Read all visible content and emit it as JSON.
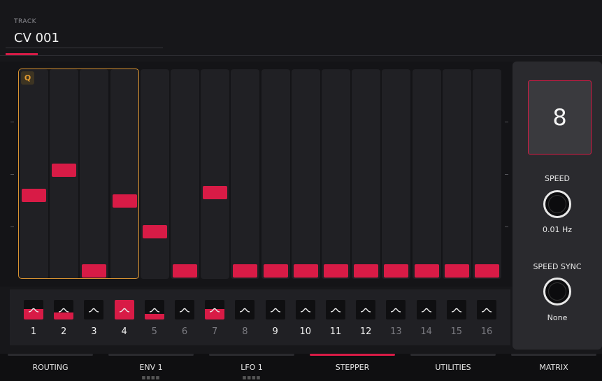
{
  "track": {
    "label": "TRACK",
    "name": "CV 001"
  },
  "quantize_badge": "Q",
  "steps": [
    {
      "number": "1",
      "level": 0.54,
      "button_fill": 0.55,
      "dim": false
    },
    {
      "number": "2",
      "level": 0.72,
      "button_fill": 0.35,
      "dim": false
    },
    {
      "number": "3",
      "level": 0.0,
      "button_fill": 0.0,
      "dim": false
    },
    {
      "number": "4",
      "level": 0.5,
      "button_fill": 1.0,
      "dim": false
    },
    {
      "number": "5",
      "level": 0.28,
      "button_fill": 0.3,
      "dim": true
    },
    {
      "number": "6",
      "level": 0.0,
      "button_fill": 0.0,
      "dim": true
    },
    {
      "number": "7",
      "level": 0.56,
      "button_fill": 0.55,
      "dim": true
    },
    {
      "number": "8",
      "level": 0.0,
      "button_fill": 0.0,
      "dim": true
    },
    {
      "number": "9",
      "level": 0.0,
      "button_fill": 0.0,
      "dim": false
    },
    {
      "number": "10",
      "level": 0.0,
      "button_fill": 0.0,
      "dim": false
    },
    {
      "number": "11",
      "level": 0.0,
      "button_fill": 0.0,
      "dim": false
    },
    {
      "number": "12",
      "level": 0.0,
      "button_fill": 0.0,
      "dim": false
    },
    {
      "number": "13",
      "level": 0.0,
      "button_fill": 0.0,
      "dim": true
    },
    {
      "number": "14",
      "level": 0.0,
      "button_fill": 0.0,
      "dim": true
    },
    {
      "number": "15",
      "level": 0.0,
      "button_fill": 0.0,
      "dim": true
    },
    {
      "number": "16",
      "level": 0.0,
      "button_fill": 0.0,
      "dim": true
    }
  ],
  "right": {
    "value": "8",
    "speed": {
      "label": "SPEED",
      "value": "0.01 Hz"
    },
    "speed_sync": {
      "label": "SPEED SYNC",
      "value": "None"
    }
  },
  "tabs": [
    {
      "label": "ROUTING",
      "dots": ""
    },
    {
      "label": "ENV 1",
      "dots": "■■■■"
    },
    {
      "label": "LFO 1",
      "dots": "■■■■"
    },
    {
      "label": "STEPPER",
      "dots": ""
    },
    {
      "label": "UTILITIES",
      "dots": ""
    },
    {
      "label": "MATRIX",
      "dots": ""
    }
  ],
  "active_tab": 3,
  "colors": {
    "accent": "#d81b46",
    "selection": "#d99331"
  },
  "icons": {
    "step_shape": "curve-icon"
  }
}
